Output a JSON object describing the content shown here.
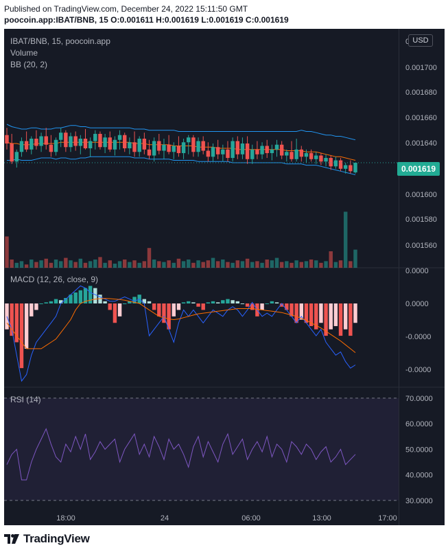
{
  "header": {
    "published": "Published on TradingView.com, December 24, 2022 15:11:50 GMT",
    "ohlc": "poocoin.app:IBAT/BNB, 15  O:0.001611 H:0.001619 L:0.001619 C:0.001619"
  },
  "legend": {
    "symbol": "IBAT/BNB, 15, poocoin.app",
    "volume": "Volume",
    "bb": "BB (20, 2)",
    "macd": "MACD (12, 26, close, 9)",
    "rsi": "RSI (14)"
  },
  "currency_button": "USD",
  "last_price_label": "0.001619",
  "footer": {
    "logo_text": "TradingView"
  },
  "colors": {
    "up": "#26a69a",
    "down": "#ef5350",
    "bb": "#2196f3",
    "bb_basis": "#ff6d00",
    "macd_line": "#2962ff",
    "signal_line": "#ff6d00",
    "rsi_line": "#7e57c2"
  },
  "chart_data": [
    {
      "type": "candlestick",
      "title": "IBAT/BNB, 15, poocoin.app",
      "x_ticks": [
        "18:00",
        "24",
        "06:00",
        "13:00",
        "17:00"
      ],
      "y_ticks": [
        "0",
        "0.001700",
        "0.001680",
        "0.001660",
        "0.001640",
        "0.001620",
        "0.001600",
        "0.001580",
        "0.001560"
      ],
      "ylim": [
        0.00155,
        0.00172
      ],
      "last_close": 0.001619,
      "ohlc": [
        {
          "o": 0.001642,
          "h": 0.001648,
          "l": 0.00163,
          "c": 0.001635
        },
        {
          "o": 0.001635,
          "h": 0.001643,
          "l": 0.001618,
          "c": 0.00162
        },
        {
          "o": 0.00162,
          "h": 0.00163,
          "l": 0.001615,
          "c": 0.001628
        },
        {
          "o": 0.001628,
          "h": 0.00164,
          "l": 0.001624,
          "c": 0.001637
        },
        {
          "o": 0.001637,
          "h": 0.001645,
          "l": 0.001628,
          "c": 0.00163
        },
        {
          "o": 0.00163,
          "h": 0.001641,
          "l": 0.001626,
          "c": 0.001639
        },
        {
          "o": 0.001639,
          "h": 0.001646,
          "l": 0.00163,
          "c": 0.001633
        },
        {
          "o": 0.001633,
          "h": 0.001644,
          "l": 0.001628,
          "c": 0.001641
        },
        {
          "o": 0.001641,
          "h": 0.001648,
          "l": 0.00163,
          "c": 0.001634
        },
        {
          "o": 0.001634,
          "h": 0.001642,
          "l": 0.001624,
          "c": 0.001628
        },
        {
          "o": 0.001628,
          "h": 0.00164,
          "l": 0.001625,
          "c": 0.001638
        },
        {
          "o": 0.001638,
          "h": 0.001648,
          "l": 0.001632,
          "c": 0.001644
        },
        {
          "o": 0.001644,
          "h": 0.001646,
          "l": 0.001628,
          "c": 0.001632
        },
        {
          "o": 0.001632,
          "h": 0.001644,
          "l": 0.001628,
          "c": 0.001641
        },
        {
          "o": 0.001641,
          "h": 0.001645,
          "l": 0.001629,
          "c": 0.001633
        },
        {
          "o": 0.001633,
          "h": 0.001642,
          "l": 0.001626,
          "c": 0.001639
        },
        {
          "o": 0.001639,
          "h": 0.001647,
          "l": 0.00163,
          "c": 0.001631
        },
        {
          "o": 0.001631,
          "h": 0.00164,
          "l": 0.001624,
          "c": 0.001637
        },
        {
          "o": 0.001637,
          "h": 0.001646,
          "l": 0.00163,
          "c": 0.001643
        },
        {
          "o": 0.001643,
          "h": 0.001645,
          "l": 0.00163,
          "c": 0.001632
        },
        {
          "o": 0.001632,
          "h": 0.001643,
          "l": 0.001627,
          "c": 0.00164
        },
        {
          "o": 0.00164,
          "h": 0.001645,
          "l": 0.001628,
          "c": 0.00163
        },
        {
          "o": 0.00163,
          "h": 0.001641,
          "l": 0.001625,
          "c": 0.001638
        },
        {
          "o": 0.001638,
          "h": 0.001646,
          "l": 0.00163,
          "c": 0.001642
        },
        {
          "o": 0.001642,
          "h": 0.001644,
          "l": 0.001628,
          "c": 0.001631
        },
        {
          "o": 0.001631,
          "h": 0.00164,
          "l": 0.001626,
          "c": 0.001636
        },
        {
          "o": 0.001636,
          "h": 0.001645,
          "l": 0.001624,
          "c": 0.001628
        },
        {
          "o": 0.001628,
          "h": 0.001641,
          "l": 0.001624,
          "c": 0.001639
        },
        {
          "o": 0.001639,
          "h": 0.001644,
          "l": 0.001626,
          "c": 0.00163
        },
        {
          "o": 0.00163,
          "h": 0.001638,
          "l": 0.001622,
          "c": 0.001625
        },
        {
          "o": 0.001625,
          "h": 0.00164,
          "l": 0.00162,
          "c": 0.001637
        },
        {
          "o": 0.001637,
          "h": 0.001643,
          "l": 0.001626,
          "c": 0.001629
        },
        {
          "o": 0.001629,
          "h": 0.001639,
          "l": 0.001622,
          "c": 0.001634
        },
        {
          "o": 0.001634,
          "h": 0.001642,
          "l": 0.001626,
          "c": 0.001628
        },
        {
          "o": 0.001628,
          "h": 0.001636,
          "l": 0.001622,
          "c": 0.001633
        },
        {
          "o": 0.001633,
          "h": 0.001641,
          "l": 0.001624,
          "c": 0.001627
        },
        {
          "o": 0.001627,
          "h": 0.001639,
          "l": 0.001622,
          "c": 0.001636
        },
        {
          "o": 0.001636,
          "h": 0.001642,
          "l": 0.001626,
          "c": 0.00164
        },
        {
          "o": 0.00164,
          "h": 0.001642,
          "l": 0.001624,
          "c": 0.001628
        },
        {
          "o": 0.001628,
          "h": 0.00164,
          "l": 0.001624,
          "c": 0.001637
        },
        {
          "o": 0.001637,
          "h": 0.001641,
          "l": 0.001626,
          "c": 0.001629
        },
        {
          "o": 0.001629,
          "h": 0.001636,
          "l": 0.00162,
          "c": 0.001624
        },
        {
          "o": 0.001624,
          "h": 0.001635,
          "l": 0.00162,
          "c": 0.001632
        },
        {
          "o": 0.001632,
          "h": 0.001638,
          "l": 0.001622,
          "c": 0.001626
        },
        {
          "o": 0.001626,
          "h": 0.001634,
          "l": 0.00162,
          "c": 0.00163
        },
        {
          "o": 0.00163,
          "h": 0.001637,
          "l": 0.00162,
          "c": 0.001623
        },
        {
          "o": 0.001623,
          "h": 0.00164,
          "l": 0.00162,
          "c": 0.001637
        },
        {
          "o": 0.001637,
          "h": 0.001641,
          "l": 0.001622,
          "c": 0.001626
        },
        {
          "o": 0.001626,
          "h": 0.00164,
          "l": 0.001622,
          "c": 0.001635
        },
        {
          "o": 0.001635,
          "h": 0.001641,
          "l": 0.001618,
          "c": 0.001622
        },
        {
          "o": 0.001622,
          "h": 0.001634,
          "l": 0.001618,
          "c": 0.00163
        },
        {
          "o": 0.00163,
          "h": 0.001637,
          "l": 0.001622,
          "c": 0.001626
        },
        {
          "o": 0.001626,
          "h": 0.001636,
          "l": 0.001622,
          "c": 0.001633
        },
        {
          "o": 0.001633,
          "h": 0.001638,
          "l": 0.001623,
          "c": 0.001627
        },
        {
          "o": 0.001627,
          "h": 0.001634,
          "l": 0.001621,
          "c": 0.00163
        },
        {
          "o": 0.00163,
          "h": 0.001638,
          "l": 0.001624,
          "c": 0.001634
        },
        {
          "o": 0.001634,
          "h": 0.001637,
          "l": 0.001622,
          "c": 0.001625
        },
        {
          "o": 0.001625,
          "h": 0.00163,
          "l": 0.00162,
          "c": 0.001628
        },
        {
          "o": 0.001628,
          "h": 0.001637,
          "l": 0.00162,
          "c": 0.001622
        },
        {
          "o": 0.001622,
          "h": 0.001639,
          "l": 0.00162,
          "c": 0.00163
        },
        {
          "o": 0.00163,
          "h": 0.001633,
          "l": 0.00162,
          "c": 0.001624
        },
        {
          "o": 0.001624,
          "h": 0.00163,
          "l": 0.001619,
          "c": 0.001627
        },
        {
          "o": 0.001627,
          "h": 0.00163,
          "l": 0.00162,
          "c": 0.001622
        },
        {
          "o": 0.001622,
          "h": 0.001628,
          "l": 0.001618,
          "c": 0.001625
        },
        {
          "o": 0.001625,
          "h": 0.001627,
          "l": 0.001617,
          "c": 0.00162
        },
        {
          "o": 0.00162,
          "h": 0.001626,
          "l": 0.001616,
          "c": 0.001623
        },
        {
          "o": 0.001623,
          "h": 0.001625,
          "l": 0.001613,
          "c": 0.001616
        },
        {
          "o": 0.001616,
          "h": 0.001624,
          "l": 0.001614,
          "c": 0.001621
        },
        {
          "o": 0.001621,
          "h": 0.001623,
          "l": 0.001612,
          "c": 0.001614
        },
        {
          "o": 0.001614,
          "h": 0.001619,
          "l": 0.00161,
          "c": 0.001617
        },
        {
          "o": 0.001617,
          "h": 0.001621,
          "l": 0.00161,
          "c": 0.001612
        },
        {
          "o": 0.001611,
          "h": 0.001619,
          "l": 0.00161,
          "c": 0.001619
        }
      ],
      "bb_upper": [
        0.001651,
        0.001649,
        0.001648,
        0.001647,
        0.001647,
        0.001648,
        0.001648,
        0.001647,
        0.001647,
        0.001647,
        0.001648,
        0.001648,
        0.001649,
        0.00165,
        0.00165,
        0.001649,
        0.001649,
        0.001648,
        0.001648,
        0.001648,
        0.001648,
        0.001648,
        0.001648,
        0.001648,
        0.001648,
        0.001648,
        0.001647,
        0.001647,
        0.001647,
        0.001646,
        0.001646,
        0.001646,
        0.001646,
        0.001646,
        0.001646,
        0.001645,
        0.001645,
        0.001645,
        0.001645,
        0.001645,
        0.001645,
        0.001645,
        0.001645,
        0.001645,
        0.001645,
        0.001645,
        0.001645,
        0.001645,
        0.001645,
        0.001645,
        0.001645,
        0.001645,
        0.001645,
        0.001645,
        0.001645,
        0.001645,
        0.001645,
        0.001645,
        0.001645,
        0.001645,
        0.001646,
        0.001645,
        0.001645,
        0.001644,
        0.001643,
        0.001642,
        0.001642,
        0.001641,
        0.001641,
        0.00164,
        0.001639,
        0.001638
      ],
      "bb_basis": [
        0.001636,
        0.001635,
        0.001635,
        0.001634,
        0.001634,
        0.001634,
        0.001635,
        0.001635,
        0.001635,
        0.001635,
        0.001635,
        0.001636,
        0.001636,
        0.001636,
        0.001636,
        0.001636,
        0.001636,
        0.001636,
        0.001636,
        0.001636,
        0.001636,
        0.001636,
        0.001636,
        0.001636,
        0.001636,
        0.001636,
        0.001635,
        0.001635,
        0.001635,
        0.001634,
        0.001634,
        0.001634,
        0.001634,
        0.001634,
        0.001633,
        0.001633,
        0.001633,
        0.001633,
        0.001633,
        0.001632,
        0.001632,
        0.001632,
        0.001632,
        0.001631,
        0.001631,
        0.001631,
        0.001631,
        0.00163,
        0.00163,
        0.00163,
        0.00163,
        0.00163,
        0.00163,
        0.00163,
        0.00163,
        0.00163,
        0.00163,
        0.001629,
        0.001629,
        0.001629,
        0.001629,
        0.001628,
        0.001628,
        0.001628,
        0.001627,
        0.001626,
        0.001625,
        0.001624,
        0.001624,
        0.001623,
        0.001622,
        0.001621
      ],
      "bb_lower": [
        0.001621,
        0.001621,
        0.001622,
        0.001621,
        0.001621,
        0.001621,
        0.001622,
        0.001623,
        0.001623,
        0.001623,
        0.001622,
        0.001623,
        0.001623,
        0.001622,
        0.001622,
        0.001623,
        0.001623,
        0.001624,
        0.001624,
        0.001624,
        0.001624,
        0.001624,
        0.001624,
        0.001624,
        0.001624,
        0.001624,
        0.001623,
        0.001623,
        0.001623,
        0.001622,
        0.001622,
        0.001622,
        0.001622,
        0.001622,
        0.001621,
        0.001621,
        0.001621,
        0.001621,
        0.001621,
        0.00162,
        0.00162,
        0.00162,
        0.00162,
        0.00162,
        0.00162,
        0.00162,
        0.001619,
        0.001619,
        0.001619,
        0.001619,
        0.001619,
        0.001619,
        0.001619,
        0.001619,
        0.001619,
        0.001619,
        0.001619,
        0.001618,
        0.001618,
        0.001618,
        0.001618,
        0.001617,
        0.001617,
        0.001617,
        0.001616,
        0.001615,
        0.001614,
        0.001613,
        0.001612,
        0.001611,
        0.00161,
        0.001609
      ],
      "volume": [
        38,
        10,
        6,
        8,
        4,
        10,
        7,
        9,
        11,
        6,
        10,
        8,
        12,
        9,
        7,
        11,
        6,
        8,
        10,
        13,
        6,
        9,
        5,
        8,
        10,
        7,
        9,
        6,
        8,
        24,
        10,
        8,
        7,
        9,
        6,
        11,
        8,
        10,
        6,
        9,
        7,
        9,
        12,
        8,
        10,
        7,
        6,
        9,
        8,
        11,
        7,
        8,
        6,
        10,
        9,
        12,
        7,
        8,
        6,
        9,
        7,
        8,
        10,
        9,
        6,
        8,
        20,
        7,
        9,
        68,
        8,
        22
      ],
      "volume_ylim": [
        0,
        75
      ]
    },
    {
      "type": "histogram+line",
      "title": "MACD (12, 26, close, 9)",
      "y_ticks": [
        "0.0000",
        "0.0000",
        "-0.0000",
        "-0.0000"
      ],
      "ylim": [
        -12,
        10
      ],
      "histogram": [
        -4,
        -5,
        -6,
        -10,
        -7,
        -2,
        -1,
        0,
        0.5,
        1,
        2,
        1.5,
        2.5,
        4,
        5,
        6,
        7,
        8,
        7,
        4,
        1,
        -1,
        -3,
        -2,
        0,
        1,
        3,
        4,
        2,
        1,
        -1,
        -2,
        -3,
        -4,
        -2,
        -1,
        0.5,
        1,
        0.5,
        -0.5,
        -1,
        0.5,
        1,
        0.5,
        1.5,
        2,
        1.5,
        1,
        0,
        -0.5,
        -1,
        -2,
        -1,
        0,
        1,
        0.5,
        -0.5,
        -1,
        -2,
        -3,
        -2.5,
        -3,
        -3.5,
        -4,
        -3,
        -5,
        -4,
        -3.5,
        -5,
        -4,
        -5,
        -3
      ],
      "macd": [
        -2,
        -4,
        -8,
        -12,
        -11,
        -8,
        -6,
        -5,
        -4,
        -3,
        -2,
        0,
        2,
        4,
        6,
        8,
        7,
        5,
        4,
        3,
        2,
        1,
        1,
        2,
        3,
        2,
        1,
        2,
        0,
        -5,
        -4,
        -3,
        -2,
        -4,
        -6,
        -3,
        -1,
        -2,
        -1,
        -2,
        -3,
        -2,
        -1,
        -1.5,
        -2,
        -1,
        -0.5,
        -1,
        -2,
        -1,
        0.5,
        -1,
        -2,
        -1.5,
        -2,
        -1,
        0,
        -1,
        -2,
        -3,
        -2,
        -3,
        -4,
        -5,
        -4,
        -6,
        -7,
        -8,
        -7.5,
        -9,
        -10,
        -9.5
      ],
      "signal": [
        -3,
        -4,
        -5,
        -6,
        -7,
        -7,
        -7,
        -7,
        -6.5,
        -6,
        -5.5,
        -4.5,
        -3.5,
        -2.5,
        -1,
        0,
        1,
        1.5,
        2,
        2.2,
        2.3,
        2.2,
        2,
        1.8,
        1.5,
        1,
        0.5,
        0,
        -0.5,
        -1,
        -1.5,
        -2,
        -2.2,
        -2.4,
        -2.5,
        -2.4,
        -2.2,
        -2,
        -1.8,
        -1.6,
        -1.5,
        -1.4,
        -1.3,
        -1.2,
        -1.1,
        -1,
        -0.9,
        -0.8,
        -0.8,
        -0.8,
        -0.8,
        -0.9,
        -1,
        -1.1,
        -1.2,
        -1.3,
        -1.4,
        -1.6,
        -1.8,
        -2,
        -2.3,
        -2.6,
        -3,
        -3.4,
        -3.8,
        -4.3,
        -4.8,
        -5.3,
        -5.8,
        -6.4,
        -7,
        -7.6
      ]
    },
    {
      "type": "line",
      "title": "RSI (14)",
      "y_ticks": [
        "70.0000",
        "60.0000",
        "50.0000",
        "40.0000",
        "30.0000"
      ],
      "ylim": [
        27,
        74
      ],
      "upper_band": 70,
      "lower_band": 30,
      "values": [
        44,
        48,
        50,
        38,
        38,
        45,
        50,
        54,
        58,
        52,
        47,
        45,
        52,
        49,
        55,
        50,
        56,
        46,
        49,
        53,
        50,
        52,
        54,
        45,
        50,
        53,
        56,
        48,
        52,
        47,
        55,
        51,
        46,
        54,
        50,
        52,
        48,
        43,
        51,
        55,
        47,
        53,
        49,
        45,
        52,
        56,
        48,
        51,
        54,
        46,
        50,
        53,
        49,
        55,
        47,
        52,
        50,
        45,
        53,
        51,
        48,
        52,
        50,
        46,
        49,
        51,
        45,
        47,
        50,
        44,
        46,
        48
      ]
    }
  ]
}
